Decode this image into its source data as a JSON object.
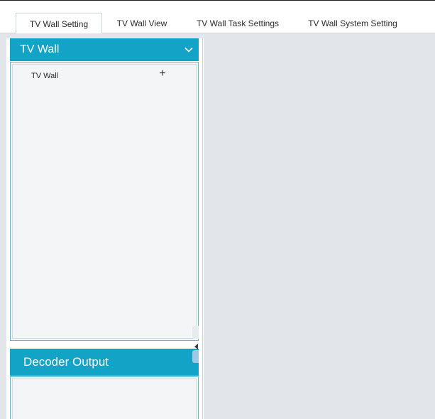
{
  "tabs": [
    {
      "label": "TV Wall Setting",
      "active": true
    },
    {
      "label": "TV Wall View",
      "active": false
    },
    {
      "label": "TV Wall Task Settings",
      "active": false
    },
    {
      "label": "TV Wall System Setting",
      "active": false
    }
  ],
  "tv_wall_panel": {
    "title": "TV Wall",
    "collapse_icon": "chevron-down-icon",
    "items": [
      {
        "label": "TV Wall",
        "action_icon": "plus-icon",
        "action_symbol": "+"
      }
    ]
  },
  "decoder_output_panel": {
    "title": "Decoder Output"
  },
  "colors": {
    "accent": "#12a3c6",
    "workspace_bg": "#e2e5e9",
    "panel_bg": "#f3f5f7"
  }
}
